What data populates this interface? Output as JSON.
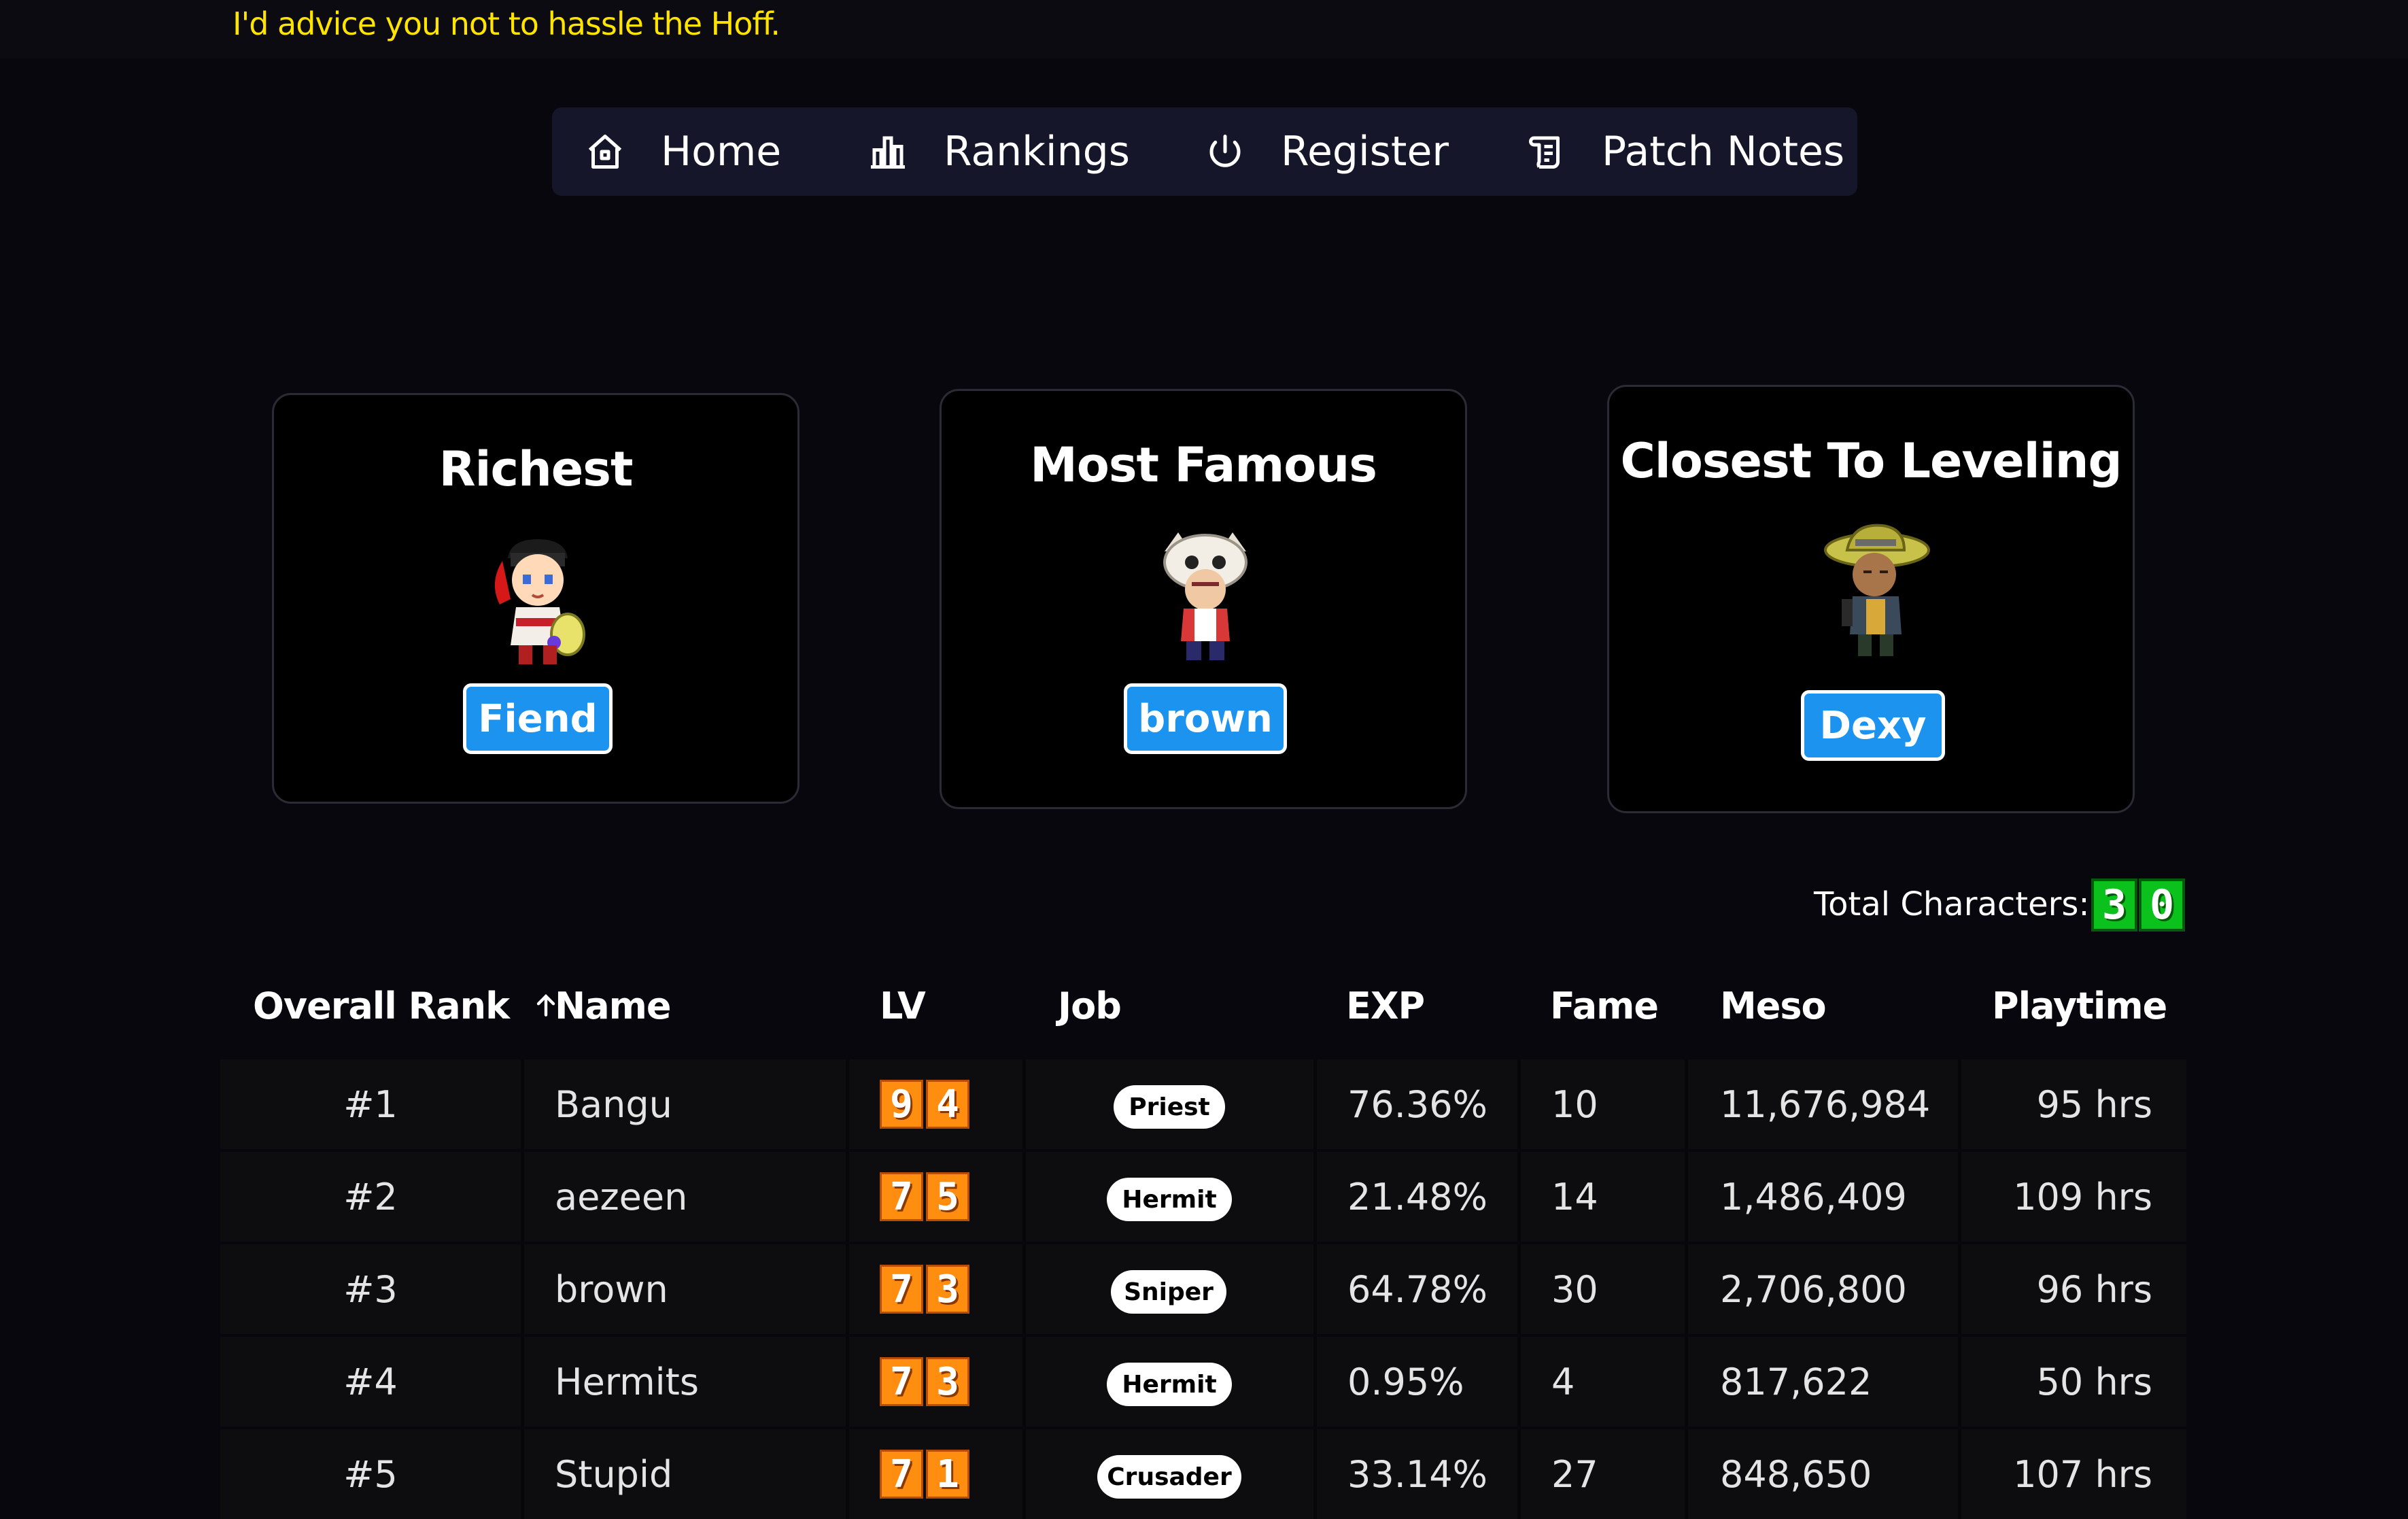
{
  "banner": {
    "text": "I'd advice you not to hassle the Hoff."
  },
  "nav": {
    "items": [
      {
        "label": "Home",
        "icon": "home-icon"
      },
      {
        "label": "Rankings",
        "icon": "bar-chart-icon"
      },
      {
        "label": "Register",
        "icon": "power-icon"
      },
      {
        "label": "Patch Notes",
        "icon": "scroll-icon"
      }
    ]
  },
  "highlights": [
    {
      "title": "Richest",
      "name": "Fiend"
    },
    {
      "title": "Most Famous",
      "name": "brown"
    },
    {
      "title": "Closest To Leveling",
      "name": "Dexy"
    }
  ],
  "total": {
    "label": "Total Characters:",
    "value": "30",
    "digits": [
      "3",
      "0"
    ]
  },
  "table": {
    "headers": [
      "Overall Rank",
      "Name",
      "LV",
      "Job",
      "EXP",
      "Fame",
      "Meso",
      "Playtime"
    ],
    "sort_icon": "arrow-up-icon",
    "rows": [
      {
        "rank": "#1",
        "name": "Bangu",
        "lv": [
          "9",
          "4"
        ],
        "job": "Priest",
        "exp": "76.36%",
        "fame": "10",
        "meso": "11,676,984",
        "playtime": "95 hrs"
      },
      {
        "rank": "#2",
        "name": "aezeen",
        "lv": [
          "7",
          "5"
        ],
        "job": "Hermit",
        "exp": "21.48%",
        "fame": "14",
        "meso": "1,486,409",
        "playtime": "109 hrs"
      },
      {
        "rank": "#3",
        "name": "brown",
        "lv": [
          "7",
          "3"
        ],
        "job": "Sniper",
        "exp": "64.78%",
        "fame": "30",
        "meso": "2,706,800",
        "playtime": "96 hrs"
      },
      {
        "rank": "#4",
        "name": "Hermits",
        "lv": [
          "7",
          "3"
        ],
        "job": "Hermit",
        "exp": "0.95%",
        "fame": "4",
        "meso": "817,622",
        "playtime": "50 hrs"
      },
      {
        "rank": "#5",
        "name": "Stupid",
        "lv": [
          "7",
          "1"
        ],
        "job": "Crusader",
        "exp": "33.14%",
        "fame": "27",
        "meso": "848,650",
        "playtime": "107 hrs"
      }
    ]
  },
  "colors": {
    "banner": "#ffe400",
    "name_button": "#1c93ef",
    "level_digit": "#ff8d10",
    "total_digit": "#0bc21c"
  }
}
